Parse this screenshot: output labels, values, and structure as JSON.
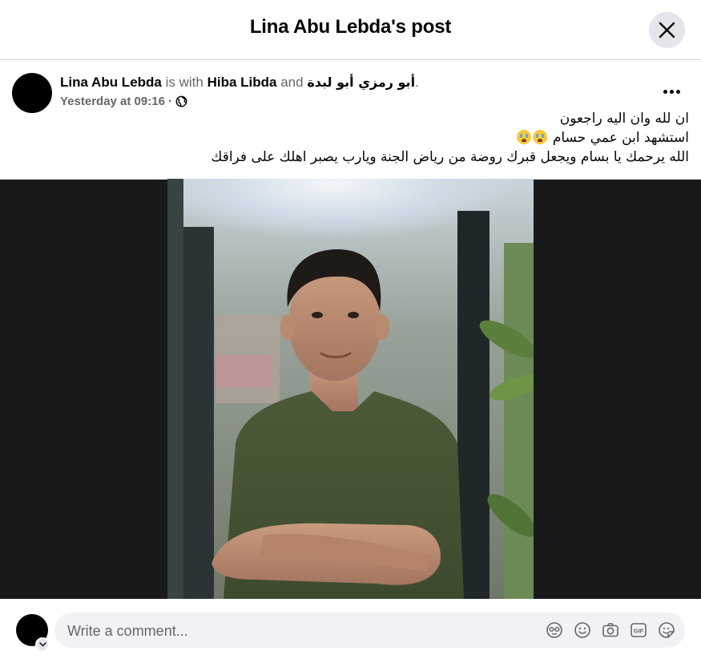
{
  "modal": {
    "title": "Lina Abu Lebda's post"
  },
  "post": {
    "author": "Lina Abu Lebda",
    "with_text": "is with",
    "tagged_1": "Hiba Libda",
    "and_text": "and",
    "tagged_2": "أبو رمزي أبو لبدة",
    "period": ".",
    "timestamp": "Yesterday at 09:16",
    "separator": "·",
    "audience_icon": "globe-icon",
    "more_icon": "more-options-icon",
    "text_lines": [
      "ان لله وان اليه راجعون",
      "استشهد ابن عمي حسام",
      "الله يرحمك يا بسام ويجعل قبرك روضة من رياض الجنة ويارب يصبر اهلك على فراقك"
    ],
    "emoji": "crying-face-emoji"
  },
  "comment": {
    "placeholder": "Write a comment...",
    "icons": [
      "avatar-sticker-icon",
      "emoji-icon",
      "camera-icon",
      "gif-icon",
      "sticker-icon"
    ]
  },
  "colors": {
    "photo_background": "#18191a",
    "comment_box": "#f0f2f5",
    "secondary_text": "#65676b",
    "close_button": "#e4e6eb"
  }
}
